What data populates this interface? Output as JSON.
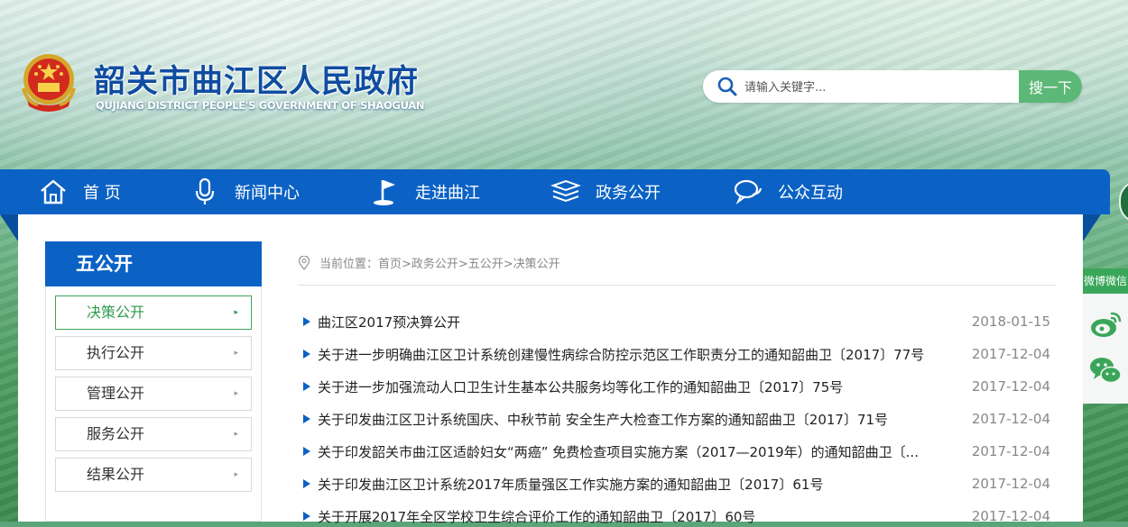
{
  "header": {
    "title": "韶关市曲江区人民政府",
    "subtitle": "QUJIANG DISTRICT PEOPLE'S GOVERNMENT OF SHAOGUAN",
    "emblem_icon": "national-emblem-icon"
  },
  "search": {
    "placeholder": "请输入关键字...",
    "button_label": "搜一下"
  },
  "nav": {
    "items": [
      {
        "label": "首 页",
        "icon": "home-icon"
      },
      {
        "label": "新闻中心",
        "icon": "microphone-icon"
      },
      {
        "label": "走进曲江",
        "icon": "flag-icon"
      },
      {
        "label": "政务公开",
        "icon": "document-stack-icon"
      },
      {
        "label": "公众互动",
        "icon": "chat-bubbles-icon"
      }
    ]
  },
  "side_float": {
    "header": "微博微信",
    "icons": [
      "weibo-icon",
      "wechat-icon"
    ]
  },
  "sidebar": {
    "title": "五公开",
    "items": [
      {
        "label": "决策公开",
        "active": true
      },
      {
        "label": "执行公开",
        "active": false
      },
      {
        "label": "管理公开",
        "active": false
      },
      {
        "label": "服务公开",
        "active": false
      },
      {
        "label": "结果公开",
        "active": false
      }
    ]
  },
  "breadcrumb": {
    "text": "当前位置：首页>政务公开>五公开>决策公开"
  },
  "articles": [
    {
      "title": "曲江区2017预决算公开",
      "date": "2018-01-15"
    },
    {
      "title": "关于进一步明确曲江区卫计系统创建慢性病综合防控示范区工作职责分工的通知韶曲卫〔2017〕77号",
      "date": "2017-12-04"
    },
    {
      "title": "关于进一步加强流动人口卫生计生基本公共服务均等化工作的通知韶曲卫〔2017〕75号",
      "date": "2017-12-04"
    },
    {
      "title": "关于印发曲江区卫计系统国庆、中秋节前 安全生产大检查工作方案的通知韶曲卫〔2017〕71号",
      "date": "2017-12-04"
    },
    {
      "title": "关于印发韶关市曲江区适龄妇女“两癌” 免费检查项目实施方案（2017—2019年）的通知韶曲卫〔...",
      "date": "2017-12-04"
    },
    {
      "title": "关于印发曲江区卫计系统2017年质量强区工作实施方案的通知韶曲卫〔2017〕61号",
      "date": "2017-12-04"
    },
    {
      "title": "关于开展2017年全区学校卫生综合评价工作的通知韶曲卫〔2017〕60号",
      "date": "2017-12-04"
    }
  ],
  "colors": {
    "nav_blue": "#0b62c4",
    "accent_green": "#5cb877",
    "title_blue": "#0f4da0"
  }
}
